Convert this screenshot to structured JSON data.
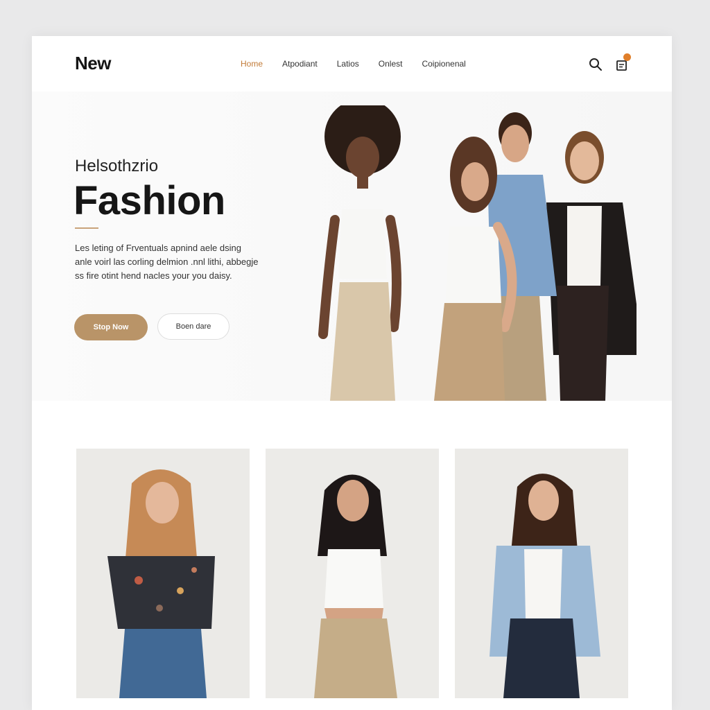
{
  "brand": {
    "logo": "New",
    "accent": "#c27b38",
    "button_color": "#b99468"
  },
  "nav": {
    "items": [
      {
        "label": "Home",
        "active": true
      },
      {
        "label": "Atpodiant",
        "active": false
      },
      {
        "label": "Latios",
        "active": false
      },
      {
        "label": "Onlest",
        "active": false
      },
      {
        "label": "Coipionenal",
        "active": false
      }
    ]
  },
  "header_icons": {
    "search": "search-icon",
    "cart": "shopping-bag-icon"
  },
  "hero": {
    "subtitle": "Helsothzrio",
    "title": "Fashion",
    "description": "Les leting of Frventuals apnind aele dsing anle voirl las corling delmion .nnl lithi, abbegje ss fire otint hend nacles your you daisy.",
    "primary_button": "Stop Now",
    "secondary_button": "Boen dare"
  },
  "products": [
    {
      "name": "floral-top-outfit"
    },
    {
      "name": "white-tank-outfit"
    },
    {
      "name": "blue-blazer-outfit"
    }
  ]
}
